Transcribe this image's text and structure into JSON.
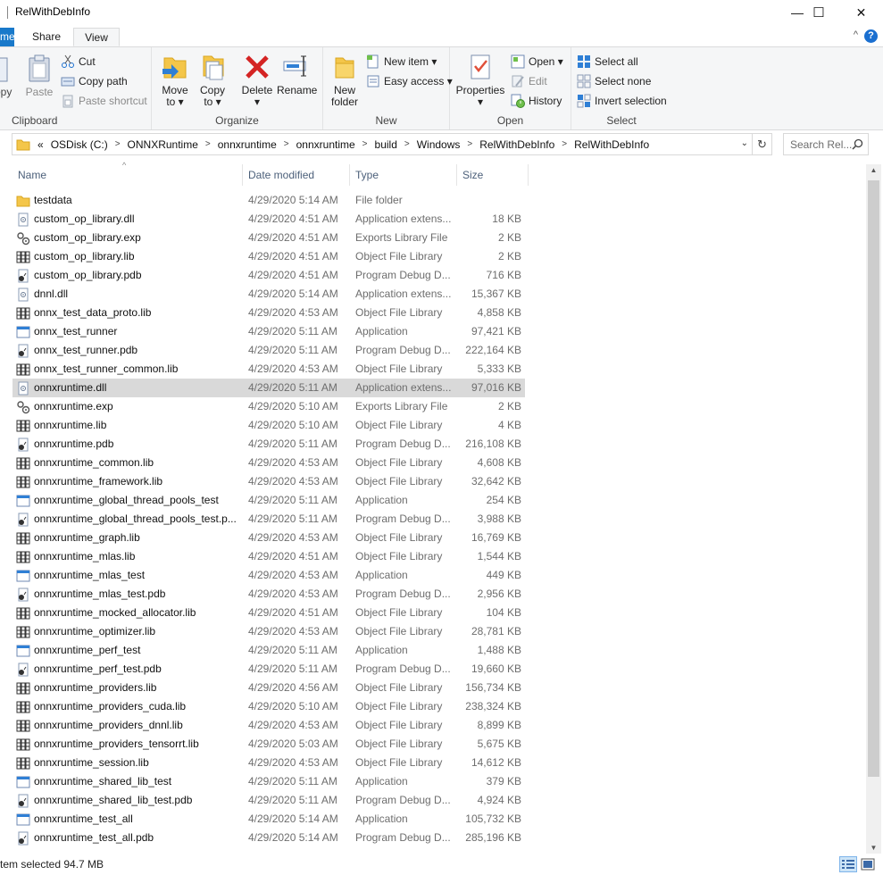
{
  "window": {
    "title": "RelWithDebInfo",
    "minimize": "—",
    "maximize": "☐",
    "close": "✕"
  },
  "tabs": {
    "file": "me",
    "share": "Share",
    "view": "View",
    "collapse": "^",
    "help": "?"
  },
  "ribbon": {
    "clipboard": {
      "label": "Clipboard",
      "copy": "opy",
      "paste": "Paste",
      "cut": "Cut",
      "copy_path": "Copy path",
      "paste_shortcut": "Paste shortcut"
    },
    "organize": {
      "label": "Organize",
      "move_to": "Move",
      "move_to2": "to ▾",
      "copy_to": "Copy",
      "copy_to2": "to ▾",
      "delete": "Delete",
      "delete2": "▾",
      "rename": "Rename"
    },
    "new": {
      "label": "New",
      "new_folder": "New",
      "new_folder2": "folder",
      "new_item": "New item ▾",
      "easy_access": "Easy access ▾"
    },
    "open": {
      "label": "Open",
      "properties": "Properties",
      "properties2": "▾",
      "open": "Open ▾",
      "edit": "Edit",
      "history": "History"
    },
    "select": {
      "label": "Select",
      "select_all": "Select all",
      "select_none": "Select none",
      "invert": "Invert selection"
    }
  },
  "address": {
    "overflow": "«",
    "crumbs": [
      "OSDisk (C:)",
      "ONNXRuntime",
      "onnxruntime",
      "onnxruntime",
      "build",
      "Windows",
      "RelWithDebInfo",
      "RelWithDebInfo"
    ],
    "separator": ">",
    "dropdown": "⌄",
    "refresh": "↻",
    "search_placeholder": "Search Rel..."
  },
  "columns": {
    "name": "Name",
    "date": "Date modified",
    "type": "Type",
    "size": "Size",
    "sort": "^"
  },
  "files": [
    {
      "name": "testdata",
      "date": "4/29/2020 5:14 AM",
      "type": "File folder",
      "size": "",
      "icon": "folder-icon"
    },
    {
      "name": "custom_op_library.dll",
      "date": "4/29/2020 4:51 AM",
      "type": "Application extens...",
      "size": "18 KB",
      "icon": "dll-icon"
    },
    {
      "name": "custom_op_library.exp",
      "date": "4/29/2020 4:51 AM",
      "type": "Exports Library File",
      "size": "2 KB",
      "icon": "exp-icon"
    },
    {
      "name": "custom_op_library.lib",
      "date": "4/29/2020 4:51 AM",
      "type": "Object File Library",
      "size": "2 KB",
      "icon": "lib-icon"
    },
    {
      "name": "custom_op_library.pdb",
      "date": "4/29/2020 4:51 AM",
      "type": "Program Debug D...",
      "size": "716 KB",
      "icon": "pdb-icon"
    },
    {
      "name": "dnnl.dll",
      "date": "4/29/2020 5:14 AM",
      "type": "Application extens...",
      "size": "15,367 KB",
      "icon": "dll-icon"
    },
    {
      "name": "onnx_test_data_proto.lib",
      "date": "4/29/2020 4:53 AM",
      "type": "Object File Library",
      "size": "4,858 KB",
      "icon": "lib-icon"
    },
    {
      "name": "onnx_test_runner",
      "date": "4/29/2020 5:11 AM",
      "type": "Application",
      "size": "97,421 KB",
      "icon": "exe-icon"
    },
    {
      "name": "onnx_test_runner.pdb",
      "date": "4/29/2020 5:11 AM",
      "type": "Program Debug D...",
      "size": "222,164 KB",
      "icon": "pdb-icon"
    },
    {
      "name": "onnx_test_runner_common.lib",
      "date": "4/29/2020 4:53 AM",
      "type": "Object File Library",
      "size": "5,333 KB",
      "icon": "lib-icon"
    },
    {
      "name": "onnxruntime.dll",
      "date": "4/29/2020 5:11 AM",
      "type": "Application extens...",
      "size": "97,016 KB",
      "icon": "dll-icon",
      "selected": true
    },
    {
      "name": "onnxruntime.exp",
      "date": "4/29/2020 5:10 AM",
      "type": "Exports Library File",
      "size": "2 KB",
      "icon": "exp-icon"
    },
    {
      "name": "onnxruntime.lib",
      "date": "4/29/2020 5:10 AM",
      "type": "Object File Library",
      "size": "4 KB",
      "icon": "lib-icon"
    },
    {
      "name": "onnxruntime.pdb",
      "date": "4/29/2020 5:11 AM",
      "type": "Program Debug D...",
      "size": "216,108 KB",
      "icon": "pdb-icon"
    },
    {
      "name": "onnxruntime_common.lib",
      "date": "4/29/2020 4:53 AM",
      "type": "Object File Library",
      "size": "4,608 KB",
      "icon": "lib-icon"
    },
    {
      "name": "onnxruntime_framework.lib",
      "date": "4/29/2020 4:53 AM",
      "type": "Object File Library",
      "size": "32,642 KB",
      "icon": "lib-icon"
    },
    {
      "name": "onnxruntime_global_thread_pools_test",
      "date": "4/29/2020 5:11 AM",
      "type": "Application",
      "size": "254 KB",
      "icon": "exe-icon"
    },
    {
      "name": "onnxruntime_global_thread_pools_test.p...",
      "date": "4/29/2020 5:11 AM",
      "type": "Program Debug D...",
      "size": "3,988 KB",
      "icon": "pdb-icon"
    },
    {
      "name": "onnxruntime_graph.lib",
      "date": "4/29/2020 4:53 AM",
      "type": "Object File Library",
      "size": "16,769 KB",
      "icon": "lib-icon"
    },
    {
      "name": "onnxruntime_mlas.lib",
      "date": "4/29/2020 4:51 AM",
      "type": "Object File Library",
      "size": "1,544 KB",
      "icon": "lib-icon"
    },
    {
      "name": "onnxruntime_mlas_test",
      "date": "4/29/2020 4:53 AM",
      "type": "Application",
      "size": "449 KB",
      "icon": "exe-icon"
    },
    {
      "name": "onnxruntime_mlas_test.pdb",
      "date": "4/29/2020 4:53 AM",
      "type": "Program Debug D...",
      "size": "2,956 KB",
      "icon": "pdb-icon"
    },
    {
      "name": "onnxruntime_mocked_allocator.lib",
      "date": "4/29/2020 4:51 AM",
      "type": "Object File Library",
      "size": "104 KB",
      "icon": "lib-icon"
    },
    {
      "name": "onnxruntime_optimizer.lib",
      "date": "4/29/2020 4:53 AM",
      "type": "Object File Library",
      "size": "28,781 KB",
      "icon": "lib-icon"
    },
    {
      "name": "onnxruntime_perf_test",
      "date": "4/29/2020 5:11 AM",
      "type": "Application",
      "size": "1,488 KB",
      "icon": "exe-icon"
    },
    {
      "name": "onnxruntime_perf_test.pdb",
      "date": "4/29/2020 5:11 AM",
      "type": "Program Debug D...",
      "size": "19,660 KB",
      "icon": "pdb-icon"
    },
    {
      "name": "onnxruntime_providers.lib",
      "date": "4/29/2020 4:56 AM",
      "type": "Object File Library",
      "size": "156,734 KB",
      "icon": "lib-icon"
    },
    {
      "name": "onnxruntime_providers_cuda.lib",
      "date": "4/29/2020 5:10 AM",
      "type": "Object File Library",
      "size": "238,324 KB",
      "icon": "lib-icon"
    },
    {
      "name": "onnxruntime_providers_dnnl.lib",
      "date": "4/29/2020 4:53 AM",
      "type": "Object File Library",
      "size": "8,899 KB",
      "icon": "lib-icon"
    },
    {
      "name": "onnxruntime_providers_tensorrt.lib",
      "date": "4/29/2020 5:03 AM",
      "type": "Object File Library",
      "size": "5,675 KB",
      "icon": "lib-icon"
    },
    {
      "name": "onnxruntime_session.lib",
      "date": "4/29/2020 4:53 AM",
      "type": "Object File Library",
      "size": "14,612 KB",
      "icon": "lib-icon"
    },
    {
      "name": "onnxruntime_shared_lib_test",
      "date": "4/29/2020 5:11 AM",
      "type": "Application",
      "size": "379 KB",
      "icon": "exe-icon"
    },
    {
      "name": "onnxruntime_shared_lib_test.pdb",
      "date": "4/29/2020 5:11 AM",
      "type": "Program Debug D...",
      "size": "4,924 KB",
      "icon": "pdb-icon"
    },
    {
      "name": "onnxruntime_test_all",
      "date": "4/29/2020 5:14 AM",
      "type": "Application",
      "size": "105,732 KB",
      "icon": "exe-icon"
    },
    {
      "name": "onnxruntime_test_all.pdb",
      "date": "4/29/2020 5:14 AM",
      "type": "Program Debug D...",
      "size": "285,196 KB",
      "icon": "pdb-icon"
    }
  ],
  "status": {
    "selection": "tem selected  94.7 MB"
  },
  "colors": {
    "accent": "#1979ca",
    "selected_row": "#d9d9d9",
    "header_text": "#4c607a"
  }
}
